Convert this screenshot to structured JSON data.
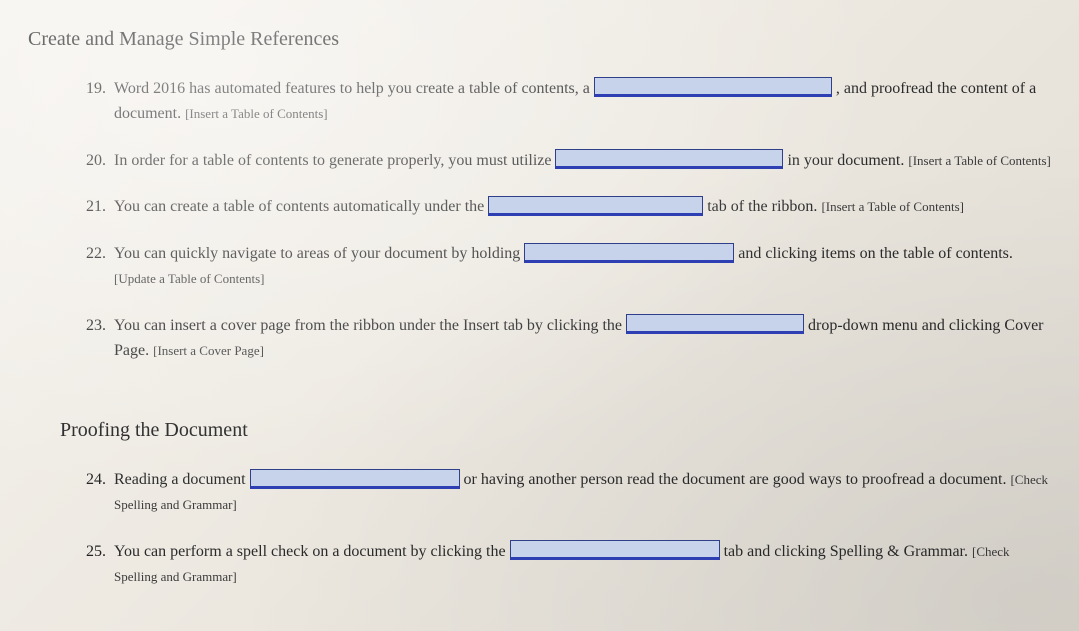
{
  "section1": {
    "heading": "Create and Manage Simple References"
  },
  "section2": {
    "heading": "Proofing the Document"
  },
  "q19": {
    "num": "19.",
    "t1": "Word 2016 has automated features to help you create a table of contents, a ",
    "t2": " , and proofread the content of a document. ",
    "hint": "[Insert a Table of Contents]"
  },
  "q20": {
    "num": "20.",
    "t1": "In order for a table of contents to generate properly, you must utilize ",
    "t2": " in your document. ",
    "hint": "[Insert a Table of Contents]"
  },
  "q21": {
    "num": "21.",
    "t1": "You can create a table of contents automatically under the ",
    "t2": " tab of the ribbon. ",
    "hint": "[Insert a Table of Contents]"
  },
  "q22": {
    "num": "22.",
    "t1": "You can quickly navigate to areas of your document by holding ",
    "t2": " and clicking items on the table of contents. ",
    "hint": "[Update a Table of Contents]"
  },
  "q23": {
    "num": "23.",
    "t1": "You can insert a cover page from the ribbon under the Insert tab by clicking the ",
    "t2": " drop-down menu and clicking Cover Page. ",
    "hint": "[Insert a Cover Page]"
  },
  "q24": {
    "num": "24.",
    "t1": "Reading a document ",
    "t2": " or having another person read the document are good ways to proofread a document. ",
    "hint": "[Check Spelling and Grammar]"
  },
  "q25": {
    "num": "25.",
    "t1": "You can perform a spell check on a document by clicking the ",
    "t2": " tab and clicking Spelling & Grammar. ",
    "hint": "[Check Spelling and Grammar]"
  }
}
